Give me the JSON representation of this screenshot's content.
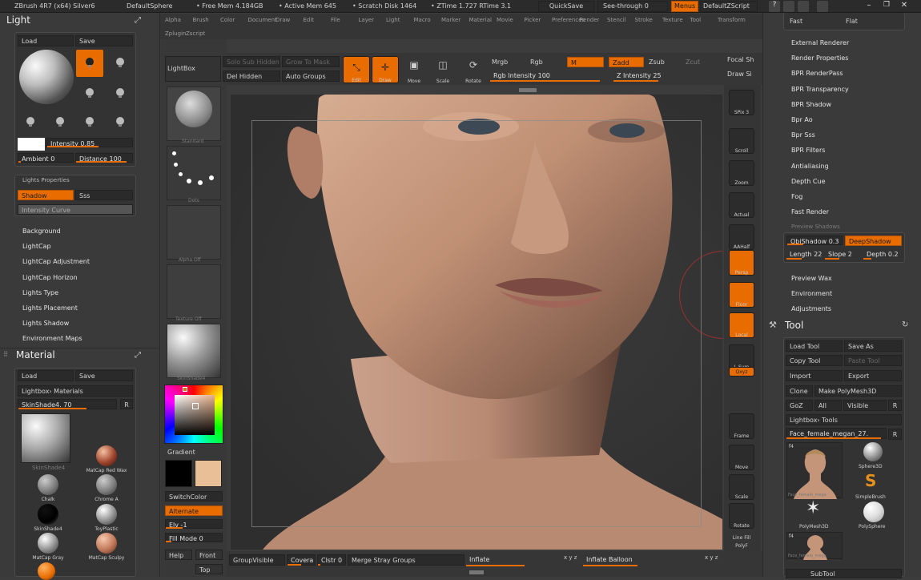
{
  "menubar": {
    "app": "ZBrush 4R7 (x64) Silver6",
    "doc": "DefaultSphere",
    "free_mem": "• Free Mem 4.184GB",
    "active_mem": "• Active Mem 645",
    "scratch": "• Scratch Disk 1464",
    "ztime": "• ZTime 1.727 RTime 3.1",
    "quicksave": "QuickSave",
    "seethrough": "See-through   0",
    "menus": "Menus",
    "script": "DefaultZScript"
  },
  "menus": [
    "Alpha",
    "Brush",
    "Color",
    "Document",
    "Draw",
    "Edit",
    "File",
    "Layer",
    "Light",
    "Macro",
    "Marker",
    "Material",
    "Movie",
    "Picker",
    "Preferences",
    "Render",
    "Stencil",
    "Stroke",
    "Texture",
    "Tool",
    "Transform",
    "Zplugin",
    "Zscript"
  ],
  "light": {
    "title": "Light",
    "load": "Load",
    "save": "Save",
    "intensity": "Intensity 0.85",
    "ambient": "Ambient 0",
    "distance": "Distance 100",
    "props": "Lights Properties",
    "shadow": "Shadow",
    "sss": "Sss",
    "curve": "Intensity Curve",
    "items": [
      "Background",
      "LightCap",
      "LightCap Adjustment",
      "LightCap Horizon",
      "Lights Type",
      "Lights Placement",
      "Lights Shadow",
      "Environment Maps"
    ]
  },
  "material": {
    "title": "Material",
    "load": "Load",
    "save": "Save",
    "lightbox": "Lightbox› Materials",
    "current": "SkinShade4. 70",
    "r": "R",
    "mats": [
      "SkinShade4",
      "MatCap Red Wax",
      "Chalk",
      "Chrome A",
      "SkinShade4",
      "ToyPlastic",
      "MatCap Gray",
      "MatCap Sculpy"
    ]
  },
  "shelf": {
    "lightbox": "LightBox",
    "mid_labels": [
      "Standard",
      "Dots",
      "Alpha Off",
      "Texture Off",
      "SkinShade4"
    ],
    "gradient": "Gradient",
    "switch": "SwitchColor",
    "alternate": "Alternate",
    "elv": "Elv -1",
    "fill": "Fill Mode 0",
    "help": "Help",
    "front": "Front",
    "top": "Top"
  },
  "toolbar": {
    "subtool": "Solo  Sub  Hidden",
    "del_hidden": "Del Hidden",
    "auto_groups": "Auto Groups",
    "up_to_mask": "Grow  To  Mask",
    "edit": "Edit",
    "draw": "Draw",
    "move": "Move",
    "scale": "Scale",
    "rotate": "Rotate",
    "mrgb": "Mrgb",
    "rgb": "Rgb",
    "m": "M",
    "rgb_intensity": "Rgb Intensity 100",
    "zadd": "Zadd",
    "zsub": "Zsub",
    "zcut": "Zcut",
    "z_intensity": "Z Intensity 25",
    "focal": "Focal Sh",
    "draw_size": "Draw Si"
  },
  "righttools": [
    "SPix 3",
    "Scroll",
    "Zoom",
    "Actual",
    "AAHalf",
    "Persp",
    "Floor",
    "Local",
    "L.Sym",
    "Qxyz",
    "Frame",
    "Move",
    "Scale",
    "Rotate",
    "Line Fill",
    "PolyF"
  ],
  "bottom": {
    "groupvisible": "GroupVisible",
    "coverage": "Covera",
    "clstr": "Clstr 0",
    "merge": "Merge Stray Groups",
    "inflate": "Inflate",
    "xyz": "x y z",
    "inflate_balloon": "Inflate Balloon",
    "xyz2": "x y z"
  },
  "render": {
    "fast": "Fast",
    "flat": "Flat",
    "items": [
      "External Renderer",
      "Render Properties",
      "BPR RenderPass",
      "BPR Transparency",
      "BPR Shadow",
      "Bpr Ao",
      "Bpr Sss",
      "BPR Filters",
      "Antialiasing",
      "Depth Cue",
      "Fog",
      "Fast Render"
    ],
    "preview_shadows": "Preview Shadows",
    "objshadow": "ObjShadow 0.3",
    "deepshadow": "DeepShadow",
    "length": "Length 22",
    "slope": "Slope 2",
    "depth": "Depth 0.2",
    "more": [
      "Preview Wax",
      "Environment",
      "Adjustments"
    ]
  },
  "tool": {
    "title": "Tool",
    "load": "Load Tool",
    "saveas": "Save As",
    "copy": "Copy Tool",
    "paste": "Paste Tool",
    "import": "Import",
    "export": "Export",
    "clone": "Clone",
    "make": "Make PolyMesh3D",
    "goz": "GoZ",
    "all": "All",
    "visible": "Visible",
    "r": "R",
    "lightbox": "Lightbox› Tools",
    "current": "Face_female_megan_27.",
    "current_r": "R",
    "thumbs": [
      "Face_female_mega",
      "Sphere3D",
      "SimpleBrush",
      "PolyMesh3D",
      "PolySphere",
      "Face_female_mega"
    ],
    "subtool": "SubTool"
  }
}
